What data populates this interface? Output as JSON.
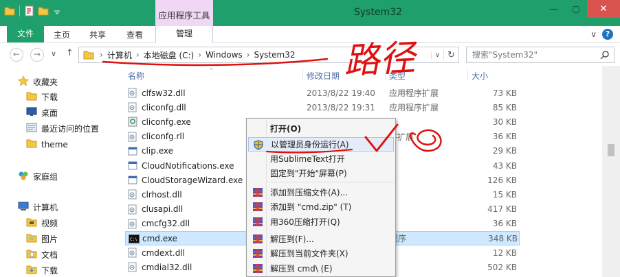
{
  "window": {
    "title": "System32",
    "tool_tab": "应用程序工具",
    "close_glyph": "✕",
    "min_glyph": "—",
    "max_glyph": "▢"
  },
  "ribbon": {
    "file": "文件",
    "tabs": [
      "主页",
      "共享",
      "查看"
    ],
    "manage": "管理",
    "expand_glyph": "∨",
    "help_glyph": "?"
  },
  "nav": {
    "back": "←",
    "forward": "→",
    "history": "∨",
    "up": "↑",
    "breadcrumbs": [
      "计算机",
      "本地磁盘 (C:)",
      "Windows",
      "System32"
    ],
    "dropdown": "∨",
    "refresh": "↻",
    "search_placeholder": "搜索\"System32\""
  },
  "sidebar": {
    "items": [
      {
        "label": "收藏夹",
        "icon": "star-icon"
      },
      {
        "label": "下载",
        "icon": "folder-icon"
      },
      {
        "label": "桌面",
        "icon": "desktop-icon"
      },
      {
        "label": "最近访问的位置",
        "icon": "recent-icon"
      },
      {
        "label": "theme",
        "icon": "folder-icon"
      },
      {
        "label": "家庭组",
        "icon": "homegroup-icon"
      },
      {
        "label": "计算机",
        "icon": "computer-icon"
      },
      {
        "label": "视频",
        "icon": "folder-icon"
      },
      {
        "label": "图片",
        "icon": "folder-icon"
      },
      {
        "label": "文档",
        "icon": "folder-icon"
      },
      {
        "label": "下载",
        "icon": "folder-icon"
      }
    ]
  },
  "columns": {
    "name": "名称",
    "date": "修改日期",
    "type": "类型",
    "size": "大小"
  },
  "files": [
    {
      "name": "clfsw32.dll",
      "date": "2013/8/22 19:40",
      "type": "应用程序扩展",
      "size": "73 KB"
    },
    {
      "name": "cliconfg.dll",
      "date": "2013/8/22 19:31",
      "type": "应用程序扩展",
      "size": "85 KB"
    },
    {
      "name": "cliconfg.exe",
      "date": "",
      "type": "",
      "size": "30 KB"
    },
    {
      "name": "cliconfg.rll",
      "date": "",
      "type": "序扩展",
      "size": "36 KB"
    },
    {
      "name": "clip.exe",
      "date": "",
      "type": "",
      "size": "29 KB"
    },
    {
      "name": "CloudNotifications.exe",
      "date": "",
      "type": "",
      "size": "43 KB"
    },
    {
      "name": "CloudStorageWizard.exe",
      "date": "",
      "type": "",
      "size": "126 KB"
    },
    {
      "name": "clrhost.dll",
      "date": "",
      "type": "",
      "size": "15 KB"
    },
    {
      "name": "clusapi.dll",
      "date": "",
      "type": "",
      "size": "417 KB"
    },
    {
      "name": "cmcfg32.dll",
      "date": "",
      "type": "",
      "size": "36 KB"
    },
    {
      "name": "cmd.exe",
      "date": "",
      "type": "程序",
      "size": "348 KB"
    },
    {
      "name": "cmdext.dll",
      "date": "",
      "type": "",
      "size": "12 KB"
    },
    {
      "name": "cmdial32.dll",
      "date": "",
      "type": "",
      "size": "502 KB"
    }
  ],
  "context_menu": {
    "items": [
      {
        "label": "打开(O)",
        "bold": true
      },
      {
        "label": "以管理员身份运行(A)",
        "icon": "shield-icon"
      },
      {
        "label": "用SublimeText打开"
      },
      {
        "label": "固定到\"开始\"屏幕(P)"
      },
      {
        "label": "添加到压缩文件(A)...",
        "icon": "winrar-icon"
      },
      {
        "label": "添加到 \"cmd.zip\" (T)",
        "icon": "winrar-icon"
      },
      {
        "label": "用360压缩打开(Q)",
        "icon": "winrar-icon"
      },
      {
        "label": "解压到(F)...",
        "icon": "winrar-icon"
      },
      {
        "label": "解压到当前文件夹(X)",
        "icon": "winrar-icon"
      },
      {
        "label": "解压到 cmd\\ (E)",
        "icon": "winrar-icon"
      }
    ]
  },
  "annotations": {
    "path_text": "路径",
    "color": "#e01010"
  }
}
